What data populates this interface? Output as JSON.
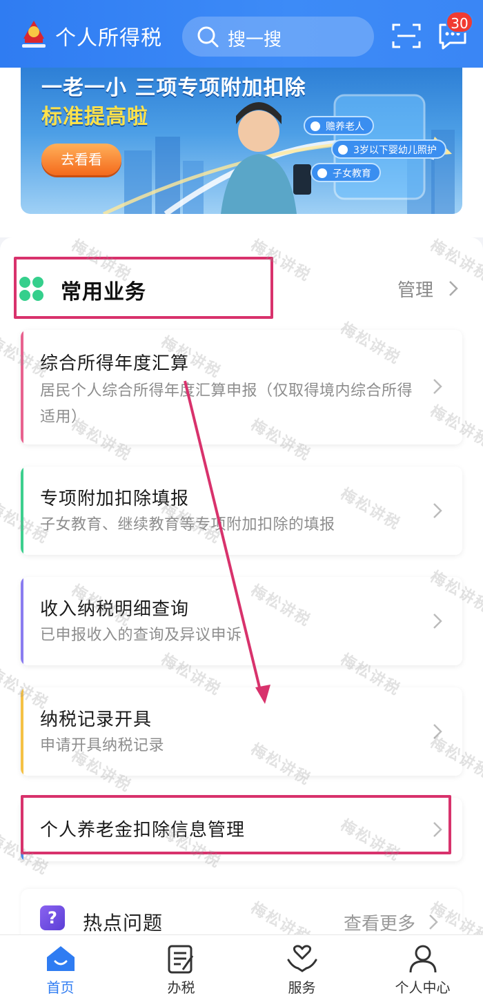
{
  "header": {
    "app_title": "个人所得税",
    "search_label": "搜一搜",
    "message_badge": "30"
  },
  "banner": {
    "title": "一老一小 三项专项附加扣除",
    "subtitle": "标准提高啦",
    "button_label": "去看看",
    "tags": [
      "赡养老人",
      "3岁以下婴幼儿照护",
      "子女教育"
    ]
  },
  "services": {
    "title": "常用业务",
    "manage_label": "管理",
    "items": [
      {
        "title": "综合所得年度汇算",
        "desc": "居民个人综合所得年度汇算申报（仅取得境内综合所得适用）",
        "accent": "#e8628f"
      },
      {
        "title": "专项附加扣除填报",
        "desc": "子女教育、继续教育等专项附加扣除的填报",
        "accent": "#3ccf8e"
      },
      {
        "title": "收入纳税明细查询",
        "desc": "已申报收入的查询及异议申诉",
        "accent": "#8a7cf0"
      },
      {
        "title": "纳税记录开具",
        "desc": "申请开具纳税记录",
        "accent": "#f5c144"
      },
      {
        "title": "个人养老金扣除信息管理",
        "desc": "",
        "accent": "#3d8bf7"
      }
    ]
  },
  "hot": {
    "icon_glyph": "?",
    "title": "热点问题",
    "more_label": "查看更多"
  },
  "tabbar": {
    "items": [
      {
        "label": "首页",
        "icon": "home-icon",
        "active": true
      },
      {
        "label": "办税",
        "icon": "tax-form-icon",
        "active": false
      },
      {
        "label": "服务",
        "icon": "service-hands-icon",
        "active": false
      },
      {
        "label": "个人中心",
        "icon": "user-icon",
        "active": false
      }
    ]
  },
  "watermark": "梅松讲税",
  "colors": {
    "brand_blue": "#2f7cf2",
    "highlight_frame": "#d8326c",
    "badge_red": "#f03b32",
    "grid_green": "#35cf8c"
  }
}
